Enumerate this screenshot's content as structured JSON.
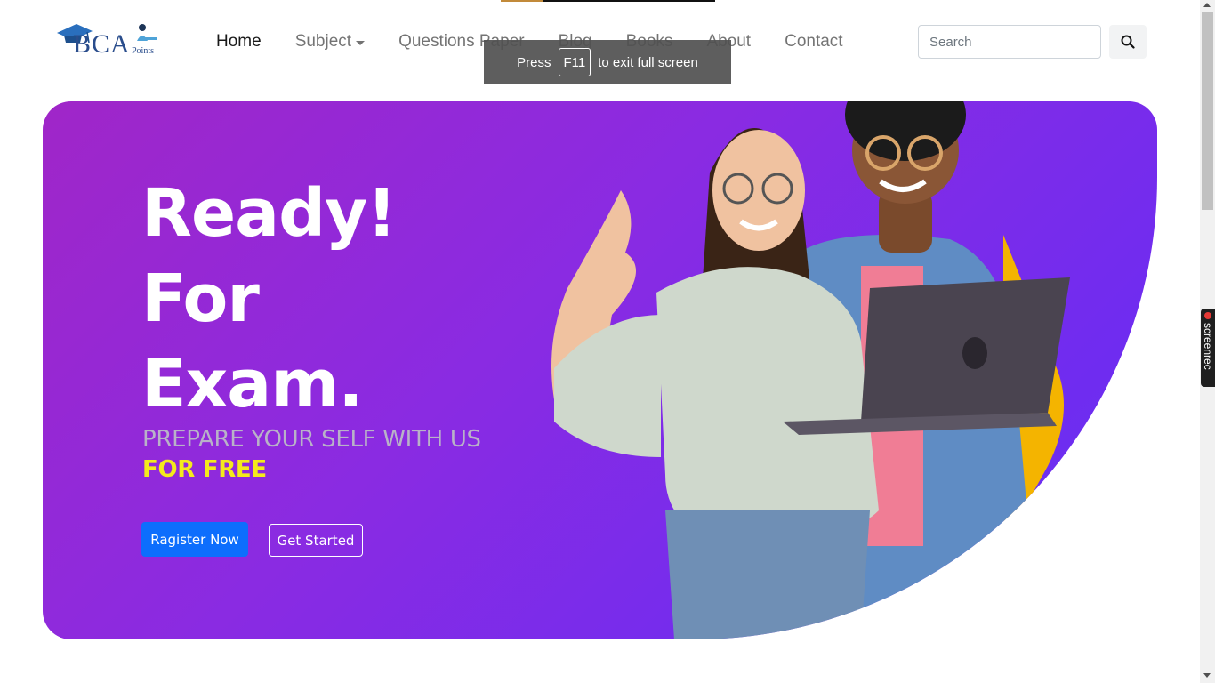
{
  "brand": {
    "name": "BCA",
    "sub": "Points"
  },
  "nav": {
    "items": [
      {
        "label": "Home"
      },
      {
        "label": "Subject"
      },
      {
        "label": "Questions Paper"
      },
      {
        "label": "Blog"
      },
      {
        "label": "Books"
      },
      {
        "label": "About"
      },
      {
        "label": "Contact"
      }
    ],
    "active": "Home"
  },
  "search": {
    "placeholder": "Search",
    "value": "",
    "button_icon": "search-icon"
  },
  "fullscreen_notice": {
    "prefix": "Press",
    "key": "F11",
    "suffix": "to exit full screen"
  },
  "hero": {
    "title_lines": [
      "Ready!",
      "For",
      "Exam."
    ],
    "subtitle": "PREPARE YOUR SELF WITH US",
    "highlight": "FOR FREE",
    "register_label": "Ragister Now",
    "start_label": "Get Started"
  },
  "screenrec": {
    "label": "screenrec"
  },
  "colors": {
    "hero_gradient_start": "#a026c8",
    "hero_gradient_end": "#6b35f3",
    "highlight_yellow": "#f4ea1c",
    "primary_button": "#0d6efd",
    "accent_shape": "#f4b400"
  }
}
